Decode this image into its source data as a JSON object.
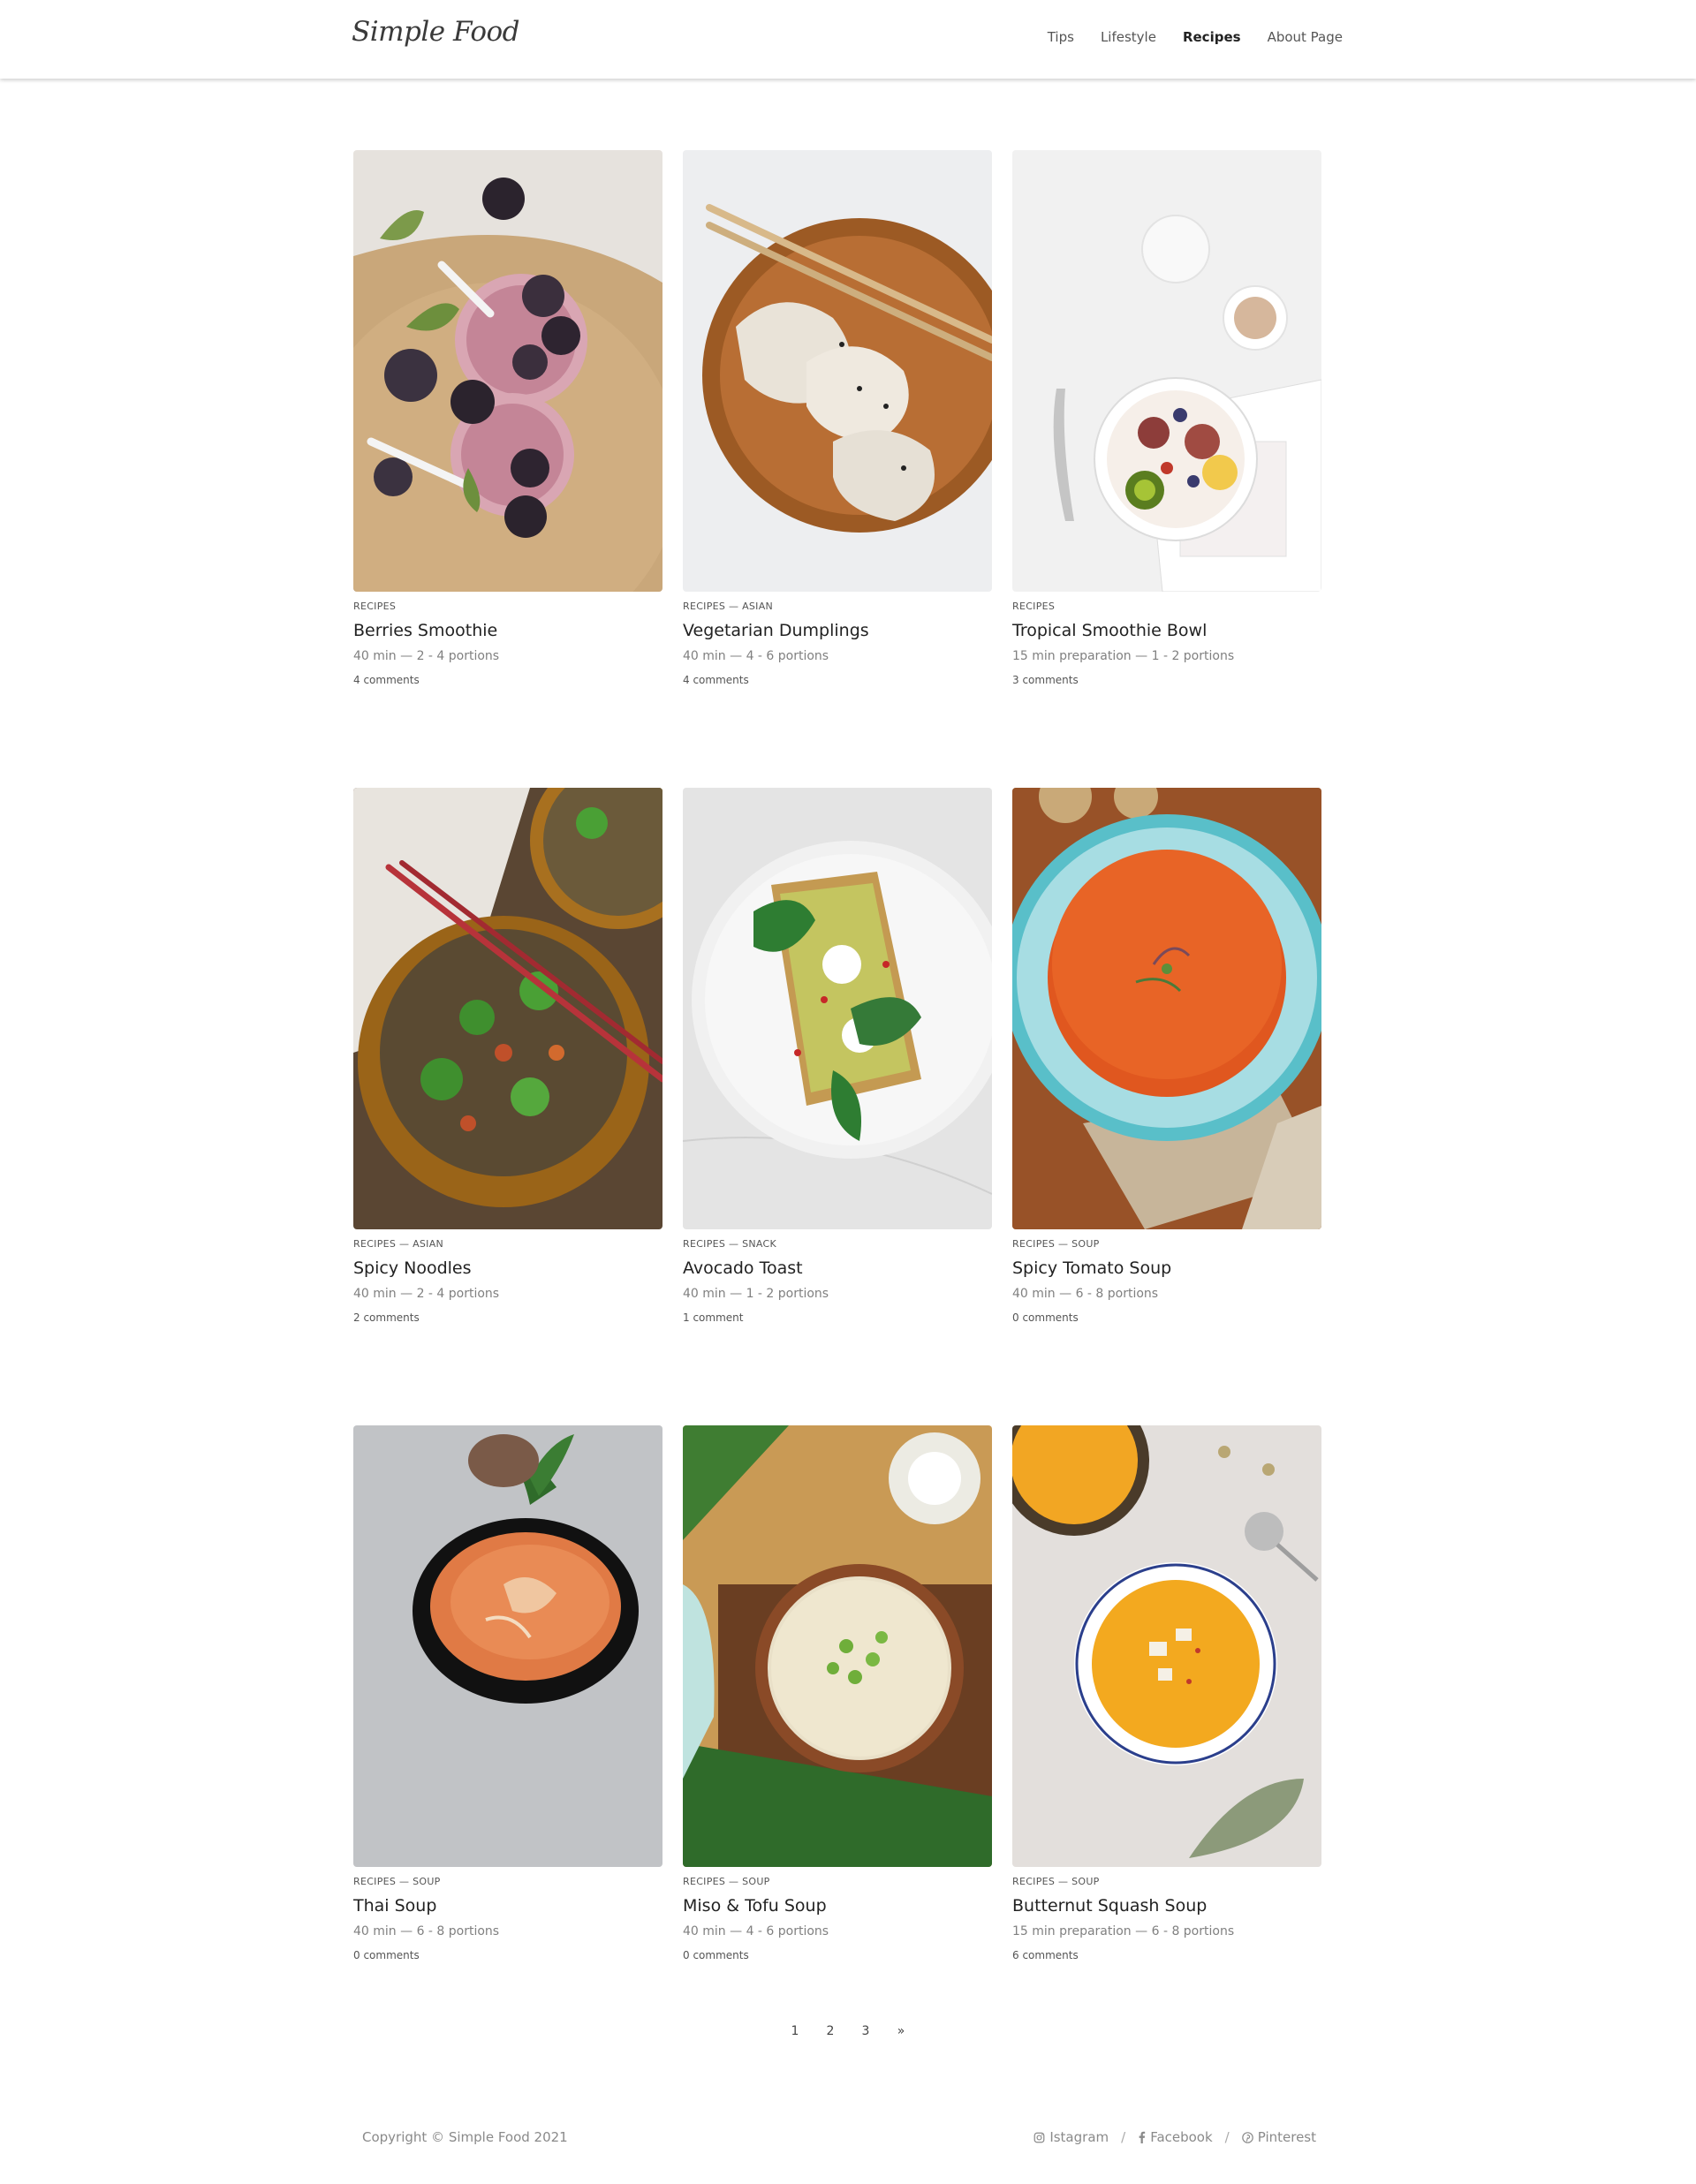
{
  "header": {
    "logo": "Simple Food",
    "nav": [
      "Tips",
      "Lifestyle",
      "Recipes",
      "About Page"
    ]
  },
  "cards": [
    {
      "category": "RECIPES",
      "title": "Berries Smoothie",
      "meta": "40 min — 2 - 4 portions",
      "comments": "4 comments"
    },
    {
      "category": "RECIPES — ASIAN",
      "title": "Vegetarian Dumplings",
      "meta": "40 min — 4 - 6 portions",
      "comments": "4 comments"
    },
    {
      "category": "RECIPES",
      "title": "Tropical Smoothie Bowl",
      "meta": "15 min preparation — 1 - 2 portions",
      "comments": "3 comments"
    },
    {
      "category": "RECIPES — ASIAN",
      "title": "Spicy Noodles",
      "meta": "40 min — 2 - 4 portions",
      "comments": "2 comments"
    },
    {
      "category": "RECIPES — SNACK",
      "title": "Avocado Toast",
      "meta": "40 min — 1 - 2 portions",
      "comments": "1 comment"
    },
    {
      "category": "RECIPES — SOUP",
      "title": "Spicy Tomato Soup",
      "meta": "40 min — 6 - 8 portions",
      "comments": "0 comments"
    },
    {
      "category": "RECIPES — SOUP",
      "title": "Thai Soup",
      "meta": "40 min — 6 - 8 portions",
      "comments": "0 comments"
    },
    {
      "category": "RECIPES — SOUP",
      "title": "Miso & Tofu Soup",
      "meta": "40 min — 4 - 6 portions",
      "comments": "0 comments"
    },
    {
      "category": "RECIPES — SOUP",
      "title": "Butternut Squash Soup",
      "meta": "15 min preparation — 6 - 8 portions",
      "comments": "6 comments"
    }
  ],
  "pagination": [
    "1",
    "2",
    "3",
    "»"
  ],
  "footer": {
    "copyright": "Copyright © Simple Food 2021",
    "social": [
      {
        "icon": "instagram-icon",
        "label": "Istagram"
      },
      {
        "icon": "facebook-icon",
        "label": "Facebook"
      },
      {
        "icon": "pinterest-icon",
        "label": "Pinterest"
      }
    ]
  }
}
